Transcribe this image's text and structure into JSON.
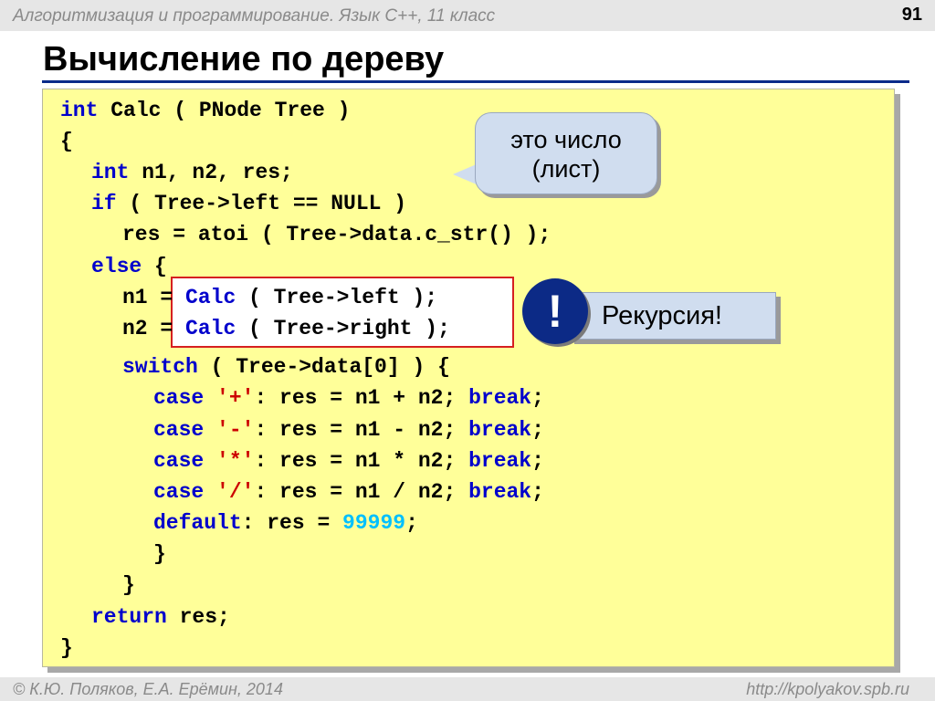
{
  "header": {
    "course": "Алгоритмизация и программирование. Язык С++, 11 класс",
    "page_number": "91"
  },
  "slide_title": "Вычисление по дереву",
  "code": {
    "l1_kw": "int",
    "l1_rest": " Calc ( PNode Tree )",
    "l2": "{",
    "l3_kw": "int",
    "l3_rest": " n1, n2, res;",
    "l4_kw": "if",
    "l4_rest": " ( Tree->left == NULL )",
    "l5": "res = atoi ( Tree->data.c_str() );",
    "l6_kw": "else",
    "l6_rest": " {",
    "l7_var": "n1 =",
    "l7_calc": "Calc",
    "l7_rest": " ( Tree->left );",
    "l8_var": "n2 =",
    "l8_calc": "Calc",
    "l8_rest": " ( Tree->right );",
    "l9_kw": "switch",
    "l9_rest": " ( Tree->data[0] ) {",
    "case_kw": "case",
    "break_kw": "break",
    "l10_ch": "'+'",
    "l10_expr": ": res = n1 + n2; ",
    "l11_ch": "'-'",
    "l11_expr": ": res = n1 - n2; ",
    "l12_ch": "'*'",
    "l12_expr": ": res = n1 * n2; ",
    "l13_ch": "'/'",
    "l13_expr": ": res = n1 / n2; ",
    "semicolon": ";",
    "l14_kw": "default",
    "l14_mid": ": res = ",
    "l14_num": "99999",
    "l15": "}",
    "l16": "}",
    "l17_kw": "return",
    "l17_rest": " res;",
    "l18": "}"
  },
  "callout_leaf": {
    "line1": "это число",
    "line2": "(лист)"
  },
  "callout_recursion": {
    "icon": "exclamation-icon",
    "mark": "!",
    "text": "Рекурсия!"
  },
  "footer": {
    "copyright": "© К.Ю. Поляков, Е.А. Ерёмин, 2014",
    "url": "http://kpolyakov.spb.ru"
  },
  "colors": {
    "code_background": "#ffff99",
    "keyword": "#0000cc",
    "string_literal": "#cc0000",
    "number_literal": "#00c0ff",
    "title_rule": "#0a2a8a",
    "highlight_border": "#d62020",
    "callout_fill": "#d0ddef",
    "exclamation_fill": "#0c2a86"
  }
}
